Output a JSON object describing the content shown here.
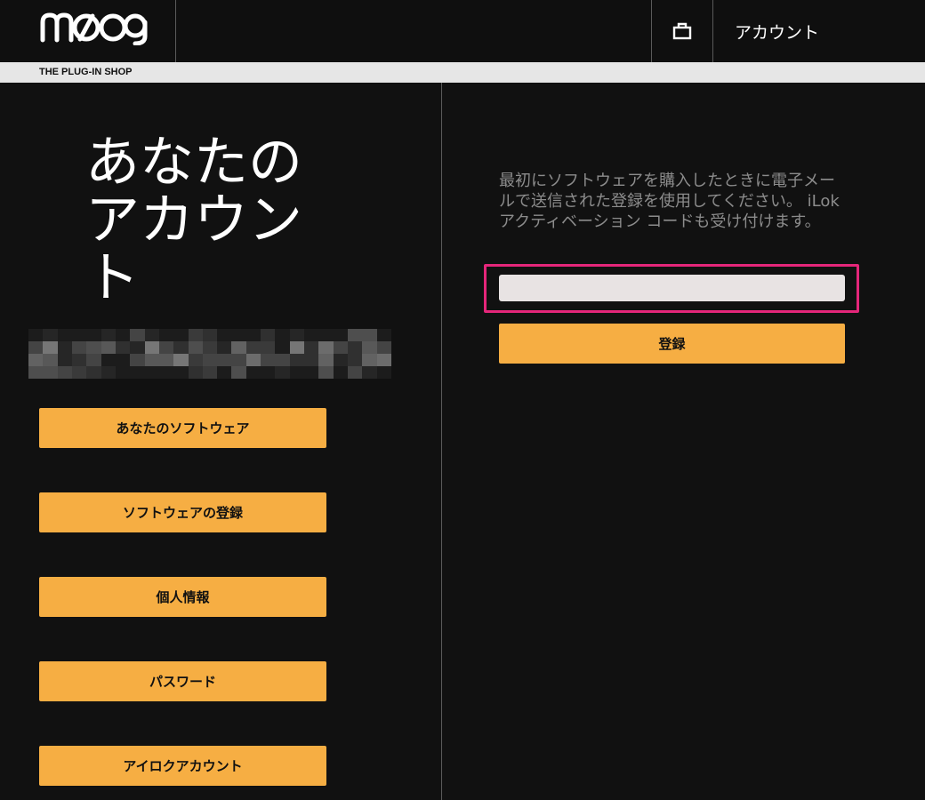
{
  "header": {
    "brand": "moog",
    "account_label": "アカウント",
    "cart_icon": "shopping-bag-icon"
  },
  "subbar": {
    "label": "THE PLUG-IN SHOP"
  },
  "sidebar": {
    "title": "あなたのアカウント",
    "nav": [
      {
        "label": "あなたのソフトウェア"
      },
      {
        "label": "ソフトウェアの登録"
      },
      {
        "label": "個人情報"
      },
      {
        "label": "パスワード"
      },
      {
        "label": "アイロクアカウント"
      }
    ]
  },
  "main": {
    "instructions": "最初にソフトウェアを購入したときに電子メールで送信された登録を使用してください。 iLok アクティベーション コードも受け付けます。",
    "code_input": {
      "value": "",
      "placeholder": ""
    },
    "register_label": "登録"
  },
  "colors": {
    "accent": "#f6ae43",
    "highlight": "#e5267a",
    "background": "#111111"
  }
}
